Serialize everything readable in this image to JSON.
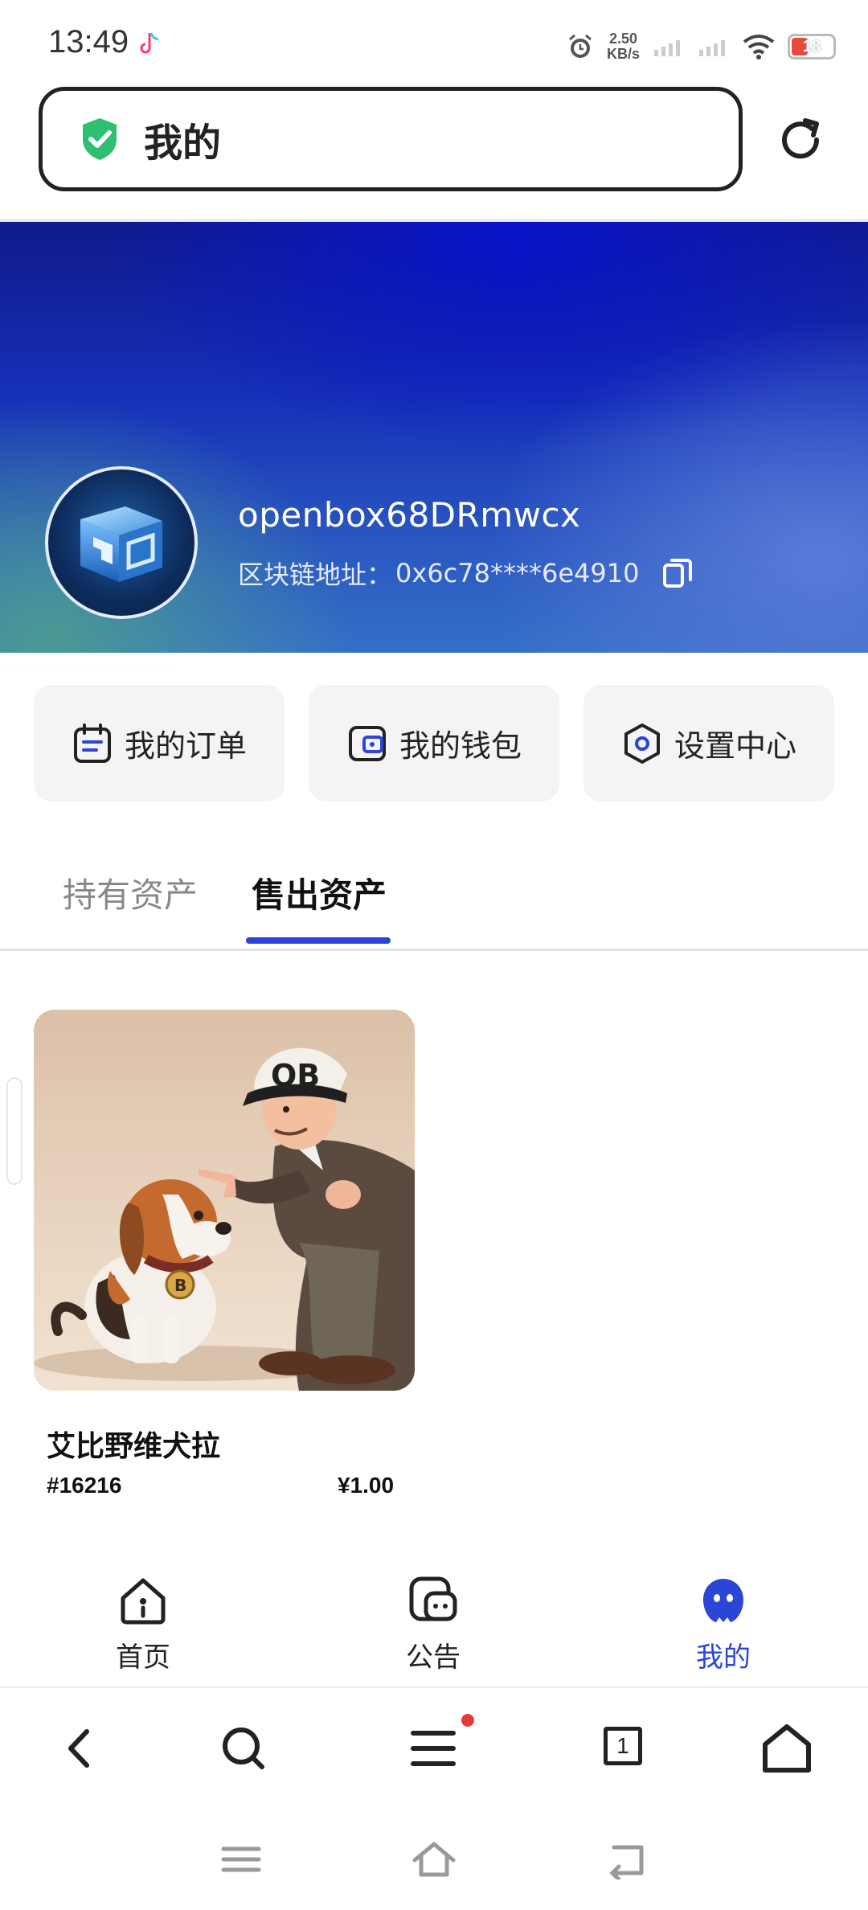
{
  "status_bar": {
    "time": "13:49",
    "net_speed_value": "2.50",
    "net_speed_unit": "KB/s",
    "battery": "18",
    "battery_color": "#e84a3c"
  },
  "address_bar": {
    "title": "我的",
    "secure_icon": "shield-check-icon",
    "refresh_icon": "refresh-icon"
  },
  "profile": {
    "username": "openbox68DRmwcx",
    "address_label": "区块链地址：",
    "address_value": "0x6c78****6e4910",
    "copy_icon": "copy-icon"
  },
  "quick_actions": [
    {
      "label": "我的订单",
      "icon": "calendar-icon"
    },
    {
      "label": "我的钱包",
      "icon": "wallet-icon"
    },
    {
      "label": "设置中心",
      "icon": "settings-icon"
    }
  ],
  "tabs": [
    {
      "label": "持有资产",
      "active": false
    },
    {
      "label": "售出资产",
      "active": true
    }
  ],
  "assets": [
    {
      "name": "艾比野维犬拉",
      "id": "#16216",
      "price": "¥1.00",
      "hat_text": "OB",
      "tag_text": "B"
    }
  ],
  "app_nav": [
    {
      "label": "首页",
      "icon": "home-icon",
      "active": false
    },
    {
      "label": "公告",
      "icon": "announcement-icon",
      "active": false
    },
    {
      "label": "我的",
      "icon": "profile-icon",
      "active": true
    }
  ],
  "browser_toolbar": {
    "tab_count": "1",
    "icons": [
      "back-icon",
      "search-icon",
      "menu-icon",
      "tabs-icon",
      "home-icon"
    ]
  },
  "colors": {
    "accent": "#2b46d6",
    "secure_green": "#2fbf71"
  }
}
